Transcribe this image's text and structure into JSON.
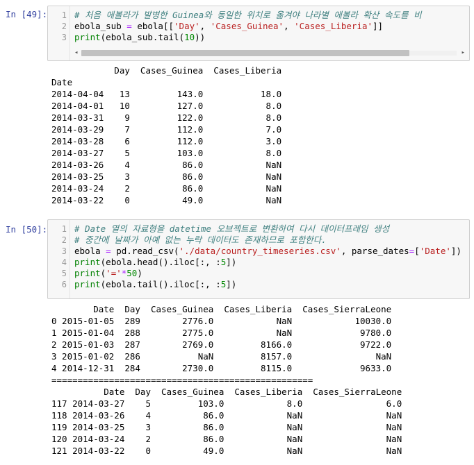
{
  "cell49": {
    "prompt": "In [49]:",
    "lines": [
      {
        "n": "1",
        "parts": [
          {
            "t": "# 처음 에볼라가 발병한 Guinea와 동일한 위치로 옮겨야 나라별 에볼라 확산 속도를 비",
            "c": "cm"
          }
        ]
      },
      {
        "n": "2",
        "parts": [
          {
            "t": "ebola_sub ",
            "c": ""
          },
          {
            "t": "=",
            "c": "op"
          },
          {
            "t": " ebola[[",
            "c": ""
          },
          {
            "t": "'Day'",
            "c": "st"
          },
          {
            "t": ", ",
            "c": ""
          },
          {
            "t": "'Cases_Guinea'",
            "c": "st"
          },
          {
            "t": ", ",
            "c": ""
          },
          {
            "t": "'Cases_Liberia'",
            "c": "st"
          },
          {
            "t": "]]",
            "c": ""
          }
        ]
      },
      {
        "n": "3",
        "parts": [
          {
            "t": "print",
            "c": "nb"
          },
          {
            "t": "(ebola_sub.tail(",
            "c": ""
          },
          {
            "t": "10",
            "c": "nm"
          },
          {
            "t": "))",
            "c": ""
          }
        ]
      }
    ],
    "scroll_left_label": "◂",
    "scroll_right_label": "▸",
    "output": [
      "            Day  Cases_Guinea  Cases_Liberia",
      "Date",
      "2014-04-04   13         143.0           18.0",
      "2014-04-01   10         127.0            8.0",
      "2014-03-31    9         122.0            8.0",
      "2014-03-29    7         112.0            7.0",
      "2014-03-28    6         112.0            3.0",
      "2014-03-27    5         103.0            8.0",
      "2014-03-26    4          86.0            NaN",
      "2014-03-25    3          86.0            NaN",
      "2014-03-24    2          86.0            NaN",
      "2014-03-22    0          49.0            NaN"
    ]
  },
  "cell50": {
    "prompt": "In [50]:",
    "lines": [
      {
        "n": "1",
        "parts": [
          {
            "t": "# Date 열의 자료형을 datetime 오브젝트로 변환하여 다시 데이터프레임 생성",
            "c": "cm"
          }
        ]
      },
      {
        "n": "2",
        "parts": [
          {
            "t": "# 중간에 날짜가 아예 없는 누락 데이터도 존재하므로 포함한다.",
            "c": "cm"
          }
        ]
      },
      {
        "n": "3",
        "parts": [
          {
            "t": "ebola ",
            "c": ""
          },
          {
            "t": "=",
            "c": "op"
          },
          {
            "t": " pd.read_csv(",
            "c": ""
          },
          {
            "t": "'./data/country_timeseries.csv'",
            "c": "st"
          },
          {
            "t": ", parse_dates",
            "c": ""
          },
          {
            "t": "=",
            "c": "op"
          },
          {
            "t": "[",
            "c": ""
          },
          {
            "t": "'Date'",
            "c": "st"
          },
          {
            "t": "])",
            "c": ""
          }
        ]
      },
      {
        "n": "4",
        "parts": [
          {
            "t": "print",
            "c": "nb"
          },
          {
            "t": "(ebola.head().iloc[:, :",
            "c": ""
          },
          {
            "t": "5",
            "c": "nm"
          },
          {
            "t": "])",
            "c": ""
          }
        ]
      },
      {
        "n": "5",
        "parts": [
          {
            "t": "print",
            "c": "nb"
          },
          {
            "t": "(",
            "c": ""
          },
          {
            "t": "'='",
            "c": "st"
          },
          {
            "t": "*",
            "c": "op"
          },
          {
            "t": "50",
            "c": "nm"
          },
          {
            "t": ")",
            "c": ""
          }
        ]
      },
      {
        "n": "6",
        "parts": [
          {
            "t": "print",
            "c": "nb"
          },
          {
            "t": "(ebola.tail().iloc[:, :",
            "c": ""
          },
          {
            "t": "5",
            "c": "nm"
          },
          {
            "t": "])",
            "c": ""
          }
        ]
      }
    ],
    "output": [
      "        Date  Day  Cases_Guinea  Cases_Liberia  Cases_SierraLeone",
      "0 2015-01-05  289        2776.0            NaN            10030.0",
      "1 2015-01-04  288        2775.0            NaN             9780.0",
      "2 2015-01-03  287        2769.0         8166.0             9722.0",
      "3 2015-01-02  286           NaN         8157.0                NaN",
      "4 2014-12-31  284        2730.0         8115.0             9633.0",
      "==================================================",
      "          Date  Day  Cases_Guinea  Cases_Liberia  Cases_SierraLeone",
      "117 2014-03-27    5         103.0            8.0                6.0",
      "118 2014-03-26    4          86.0            NaN                NaN",
      "119 2014-03-25    3          86.0            NaN                NaN",
      "120 2014-03-24    2          86.0            NaN                NaN",
      "121 2014-03-22    0          49.0            NaN                NaN"
    ]
  }
}
